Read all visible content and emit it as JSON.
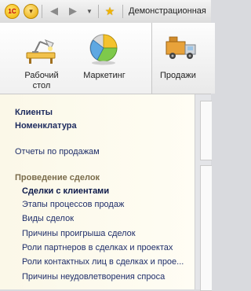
{
  "titlebar": {
    "logo_text": "1С",
    "menu_glyph": "▾",
    "back_glyph": "◀",
    "forward_glyph": "▶",
    "dropdown_glyph": "▼",
    "star_glyph": "★",
    "title": "Демонстрационная"
  },
  "sections": [
    {
      "label": "Рабочий\nстол",
      "icon": "desk-lamp-icon"
    },
    {
      "label": "Маркетинг",
      "icon": "pie-chart-icon"
    },
    {
      "label": "Продажи",
      "icon": "truck-icon"
    }
  ],
  "nav": {
    "items": [
      {
        "label": "Клиенты",
        "style": "bold"
      },
      {
        "label": "Номенклатура",
        "style": "bold"
      },
      {
        "label": "Отчеты по продажам",
        "style": "plain"
      },
      {
        "label": "Проведение сделок",
        "style": "group"
      },
      {
        "label": "Сделки с клиентами",
        "style": "sub-bold"
      },
      {
        "label": "Этапы процессов продаж",
        "style": "sub"
      },
      {
        "label": "Виды сделок",
        "style": "sub"
      },
      {
        "label": "Причины проигрыша сделок",
        "style": "sub"
      },
      {
        "label": "Роли партнеров в сделках и проектах",
        "style": "sub"
      },
      {
        "label": "Роли контактных лиц в сделках и прое...",
        "style": "sub"
      },
      {
        "label": "Причины неудовлетворения спроса",
        "style": "sub"
      }
    ]
  },
  "colors": {
    "nav_bg": "#fbf8e8",
    "link": "#1f2e6a",
    "group": "#7a6c4b"
  }
}
